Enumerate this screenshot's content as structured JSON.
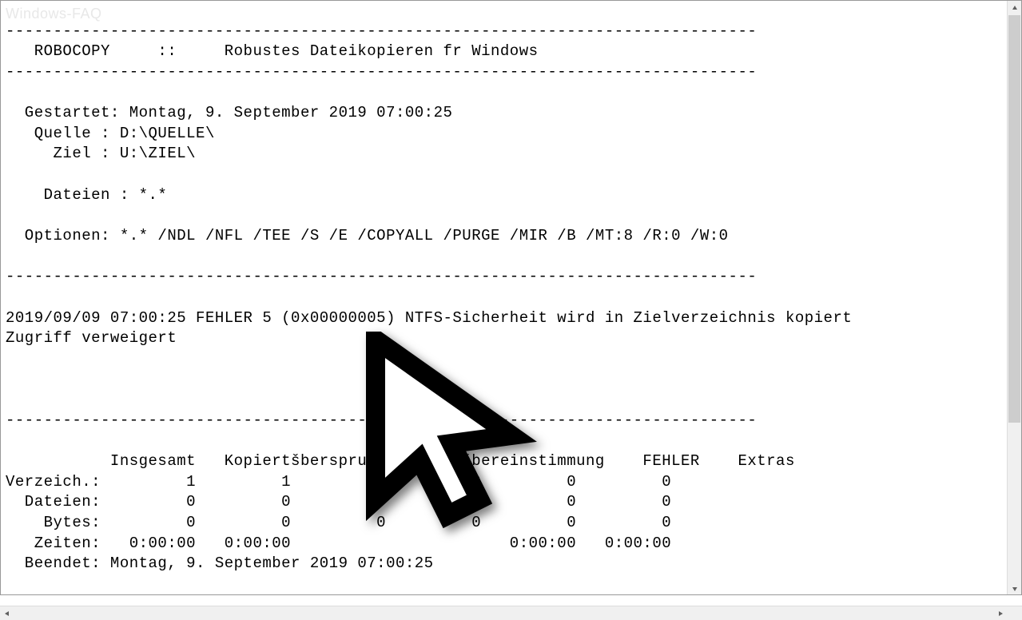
{
  "watermark": "Windows-FAQ",
  "separator": "-------------------------------------------------------------------------------",
  "header": "   ROBOCOPY     ::     Robustes Dateikopieren fr Windows",
  "info": {
    "gestartet": "  Gestartet: Montag, 9. September 2019 07:00:25",
    "quelle": "   Quelle : D:\\QUELLE\\",
    "ziel": "     Ziel : U:\\ZIEL\\",
    "dateien": "    Dateien : *.*",
    "optionen": "  Optionen: *.* /NDL /NFL /TEE /S /E /COPYALL /PURGE /MIR /B /MT:8 /R:0 /W:0"
  },
  "error": {
    "line1": "2019/09/09 07:00:25 FEHLER 5 (0x00000005) NTFS-Sicherheit wird in Zielverzeichnis kopiert",
    "line2": "Zugriff verweigert"
  },
  "summary": {
    "header": "           Insgesamt   KopiertšbersprungenKeine šbereinstimmung    FEHLER    Extras",
    "verzeich": "Verzeich.:         1         1         0         0         0         0",
    "dateien": "  Dateien:         0         0         0         0         0         0",
    "bytes": "    Bytes:         0         0         0         0         0         0",
    "zeiten": "   Zeiten:   0:00:00   0:00:00                       0:00:00   0:00:00",
    "beendet": "  Beendet: Montag, 9. September 2019 07:00:25"
  }
}
